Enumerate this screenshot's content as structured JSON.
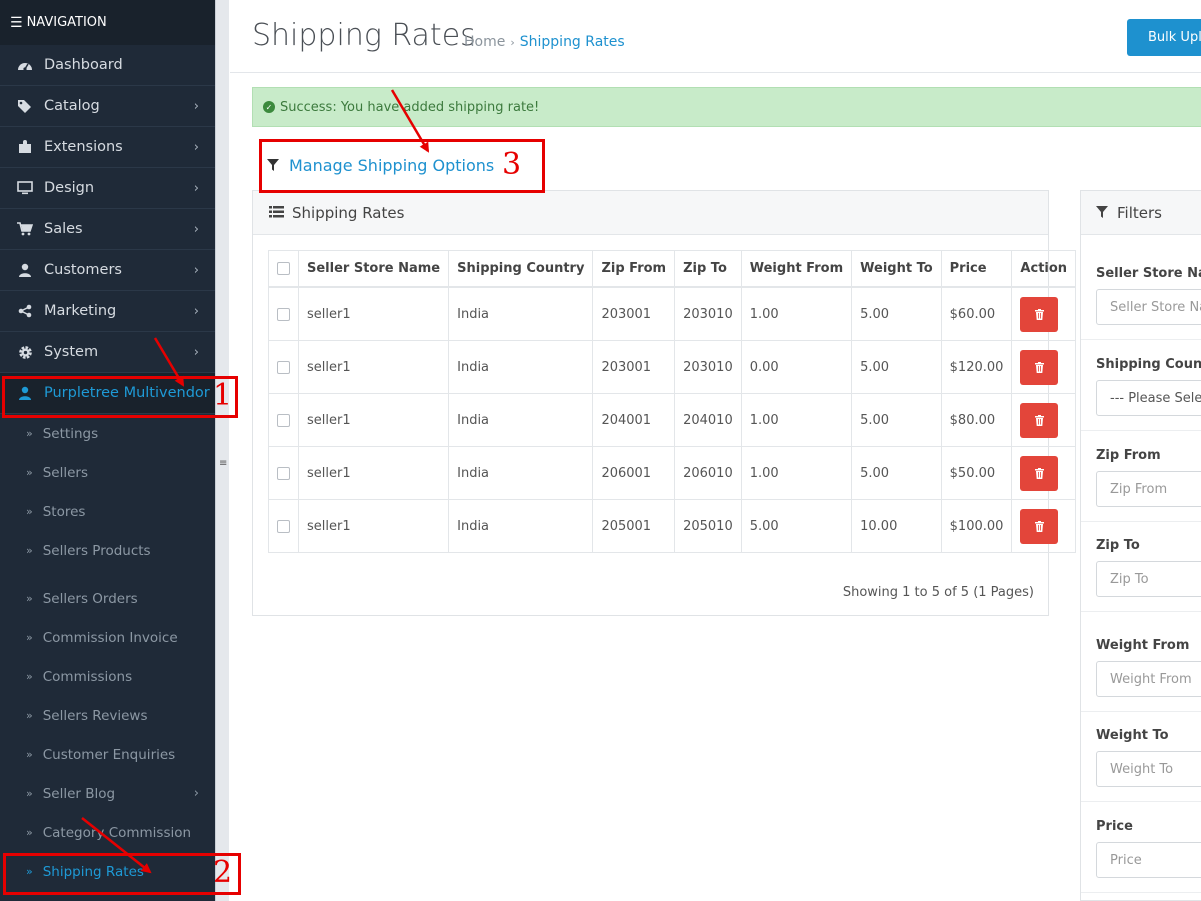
{
  "sidebar": {
    "header": "NAVIGATION",
    "items": [
      {
        "label": "Dashboard",
        "icon": "dashboard-icon"
      },
      {
        "label": "Catalog",
        "icon": "tags-icon"
      },
      {
        "label": "Extensions",
        "icon": "puzzle-icon"
      },
      {
        "label": "Design",
        "icon": "monitor-icon"
      },
      {
        "label": "Sales",
        "icon": "cart-icon"
      },
      {
        "label": "Customers",
        "icon": "user-icon"
      },
      {
        "label": "Marketing",
        "icon": "share-icon"
      },
      {
        "label": "System",
        "icon": "gear-icon"
      },
      {
        "label": "Purpletree Multivendor",
        "icon": "user-icon"
      }
    ],
    "subitems": [
      "Settings",
      "Sellers",
      "Stores",
      "Sellers Products",
      "Sellers Orders",
      "Commission Invoice",
      "Commissions",
      "Sellers Reviews",
      "Customer Enquiries",
      "Seller Blog",
      "Category Commission",
      "Shipping Rates"
    ]
  },
  "header": {
    "title": "Shipping Rates",
    "breadcrumb": [
      "Home",
      "Shipping Rates"
    ],
    "bulk_upload_label": "Bulk Uple"
  },
  "alert": {
    "text": "Success: You have added shipping rate!"
  },
  "manage_link": "Manage Shipping Options",
  "rates_panel": {
    "title": "Shipping Rates",
    "columns": [
      "Seller Store Name",
      "Shipping Country",
      "Zip From",
      "Zip To",
      "Weight From",
      "Weight To",
      "Price",
      "Action"
    ],
    "rows": [
      [
        "seller1",
        "India",
        "203001",
        "203010",
        "1.00",
        "5.00",
        "$60.00"
      ],
      [
        "seller1",
        "India",
        "203001",
        "203010",
        "0.00",
        "5.00",
        "$120.00"
      ],
      [
        "seller1",
        "India",
        "204001",
        "204010",
        "1.00",
        "5.00",
        "$80.00"
      ],
      [
        "seller1",
        "India",
        "206001",
        "206010",
        "1.00",
        "5.00",
        "$50.00"
      ],
      [
        "seller1",
        "India",
        "205001",
        "205010",
        "5.00",
        "10.00",
        "$100.00"
      ]
    ],
    "pagination": "Showing 1 to 5 of 5 (1 Pages)"
  },
  "filters": {
    "title": "Filters",
    "fields": [
      {
        "label": "Seller Store Nam",
        "placeholder": "Seller Store Nar"
      },
      {
        "label": "Shipping Countr",
        "placeholder": "--- Please Selec"
      },
      {
        "label": "Zip From",
        "placeholder": "Zip From"
      },
      {
        "label": "Zip To",
        "placeholder": "Zip To"
      },
      {
        "label": "Weight From",
        "placeholder": "Weight From"
      },
      {
        "label": "Weight To",
        "placeholder": "Weight To"
      },
      {
        "label": "Price",
        "placeholder": "Price"
      }
    ]
  },
  "annotations": {
    "step1": "1",
    "step2": "2",
    "step3": "3",
    "color": "#e60000"
  }
}
